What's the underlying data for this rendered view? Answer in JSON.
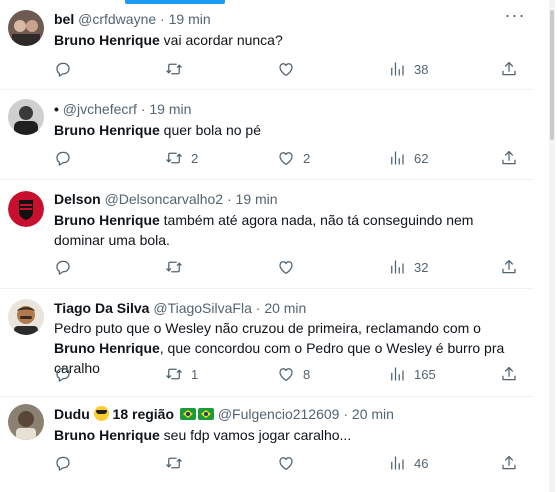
{
  "tweets": [
    {
      "name": "bel",
      "handle": "@crfdwayne",
      "time": "19 min",
      "highlight": "Bruno Henrique",
      "text": " vai acordar nunca?",
      "replies": "",
      "retweets": "",
      "likes": "",
      "views": "38",
      "avatar_color": "#5b4a46"
    },
    {
      "name": "•",
      "handle": "@jvchefecrf",
      "time": "19 min",
      "highlight": "Bruno Henrique",
      "text": " quer bola no pé",
      "replies": "",
      "retweets": "2",
      "likes": "2",
      "views": "62",
      "avatar_color": "#3d3d3d"
    },
    {
      "name": "Delson",
      "handle": "@Delsoncarvalho2",
      "time": "19 min",
      "highlight": "Bruno Henrique",
      "text": " também até agora nada, não tá conseguindo nem dominar uma bola.",
      "replies": "",
      "retweets": "",
      "likes": "",
      "views": "32",
      "avatar_color": "#c8102e"
    },
    {
      "name": "Tiago Da Silva",
      "handle": "@TiagoSilvaFla",
      "time": "20 min",
      "text_before": "Pedro puto que o Wesley não cruzou de primeira, reclamando com o ",
      "highlight": "Bruno Henrique",
      "text": ", que concordou com o Pedro que o Wesley é burro pra caralho",
      "replies": "",
      "retweets": "1",
      "likes": "8",
      "views": "165",
      "avatar_color": "#b07a4f"
    },
    {
      "name_prefix": "Dudu",
      "name_suffix": "18 região",
      "handle": "@Fulgencio212609",
      "time": "20 min",
      "highlight": "Bruno Henrique",
      "text": " seu fdp vamos jogar caralho...",
      "replies": "",
      "retweets": "",
      "likes": "",
      "views": "46",
      "avatar_color": "#6b6255"
    }
  ],
  "separator": "·",
  "icons": {
    "reply": "reply-icon",
    "retweet": "retweet-icon",
    "like": "heart-icon",
    "views": "views-icon",
    "share": "share-icon",
    "more": "more-icon"
  },
  "colors": {
    "accent": "#1d9bf0",
    "text": "#0f1419",
    "muted": "#536471",
    "divider": "#eff3f4"
  }
}
